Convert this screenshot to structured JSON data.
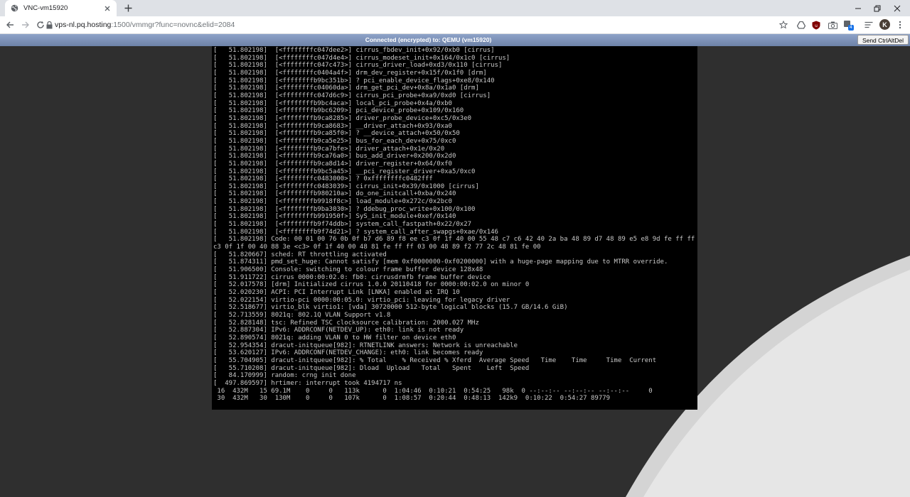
{
  "browser": {
    "tab_title": "VNC-vm15920",
    "url_host": "vps-nl.pq.hosting",
    "url_path": ":1500/vmmgr?func=novnc&elid=2084",
    "profile_initial": "K",
    "extension_badge": "4",
    "icons": [
      "globe-icon",
      "close-icon",
      "plus-icon",
      "back-arrow-icon",
      "forward-arrow-icon",
      "reload-icon",
      "lock-icon",
      "star-icon",
      "drive-icon",
      "ublock-icon",
      "camera-icon",
      "extension-icon",
      "reading-list-icon",
      "minimize-icon",
      "restore-icon",
      "window-close-icon"
    ]
  },
  "vnc": {
    "status": "Connected (encrypted) to: QEMU (vm15920)",
    "send_cad": "Send CtrlAltDel",
    "colors": {
      "statusbar": "#7b90b6",
      "console_bg": "#000000",
      "console_fg": "#c8c8c8",
      "page_bg": "#2f2f2f"
    }
  },
  "console": {
    "lines": [
      "[   51.802198]  [<ffffffffc047dee2>] cirrus_fbdev_init+0x92/0xb0 [cirrus]",
      "[   51.802198]  [<ffffffffc047d4e4>] cirrus_modeset_init+0x164/0x1c0 [cirrus]",
      "[   51.802198]  [<ffffffffc047c473>] cirrus_driver_load+0xd3/0x110 [cirrus]",
      "[   51.802198]  [<ffffffffc0404a4f>] drm_dev_register+0x15f/0x1f0 [drm]",
      "[   51.802198]  [<ffffffffb9bc351b>] ? pci_enable_device_flags+0xe8/0x140",
      "[   51.802198]  [<ffffffffc04060da>] drm_get_pci_dev+0x8a/0x1a0 [drm]",
      "[   51.802198]  [<ffffffffc047d6c9>] cirrus_pci_probe+0xa9/0xd0 [cirrus]",
      "[   51.802198]  [<ffffffffb9bc4aca>] local_pci_probe+0x4a/0xb0",
      "[   51.802198]  [<ffffffffb9bc6209>] pci_device_probe+0x109/0x160",
      "[   51.802198]  [<ffffffffb9ca8285>] driver_probe_device+0xc5/0x3e0",
      "[   51.802198]  [<ffffffffb9ca8683>] __driver_attach+0x93/0xa0",
      "[   51.802198]  [<ffffffffb9ca85f0>] ? __device_attach+0x50/0x50",
      "[   51.802198]  [<ffffffffb9ca5e25>] bus_for_each_dev+0x75/0xc0",
      "[   51.802198]  [<ffffffffb9ca7bfe>] driver_attach+0x1e/0x20",
      "[   51.802198]  [<ffffffffb9ca76a0>] bus_add_driver+0x200/0x2d0",
      "[   51.802198]  [<ffffffffb9ca8d14>] driver_register+0x64/0xf0",
      "[   51.802198]  [<ffffffffb9bc5a45>] __pci_register_driver+0xa5/0xc0",
      "[   51.802198]  [<ffffffffc0483000>] ? 0xffffffffc0482fff",
      "[   51.802198]  [<ffffffffc0483039>] cirrus_init+0x39/0x1000 [cirrus]",
      "[   51.802198]  [<ffffffffb980210a>] do_one_initcall+0xba/0x240",
      "[   51.802198]  [<ffffffffb9918f8c>] load_module+0x272c/0x2bc0",
      "[   51.802198]  [<ffffffffb9ba3030>] ? ddebug_proc_write+0x100/0x100",
      "[   51.802198]  [<ffffffffb991950f>] SyS_init_module+0xef/0x140",
      "[   51.802198]  [<ffffffffb9f74ddb>] system_call_fastpath+0x22/0x27",
      "[   51.802198]  [<ffffffffb9f74d21>] ? system_call_after_swapgs+0xae/0x146",
      "[   51.802198] Code: 00 01 00 76 0b 0f b7 d6 89 f8 ee c3 0f 1f 40 00 55 48 c7 c6 42 40 2a ba 48 89 d7 48 89 e5 e8 9d fe ff ff 5d",
      "c3 0f 1f 00 40 88 3e <c3> 0f 1f 40 00 48 81 fe ff ff 03 00 48 89 f2 77 2c 48 81 fe 00",
      "[   51.820667] sched: RT throttling activated",
      "[   51.874311] pmd_set_huge: Cannot satisfy [mem 0xf0000000-0xf0200000] with a huge-page mapping due to MTRR override.",
      "[   51.906500] Console: switching to colour frame buffer device 128x48",
      "[   51.911722] cirrus 0000:00:02.0: fb0: cirrusdrmfb frame buffer device",
      "[   52.017578] [drm] Initialized cirrus 1.0.0 20110418 for 0000:00:02.0 on minor 0",
      "[   52.020230] ACPI: PCI Interrupt Link [LNKA] enabled at IRQ 10",
      "[   52.022154] virtio-pci 0000:00:05.0: virtio_pci: leaving for legacy driver",
      "[   52.518677] virtio_blk virtio1: [vda] 30720000 512-byte logical blocks (15.7 GB/14.6 GiB)",
      "[   52.713559] 8021q: 802.1Q VLAN Support v1.8",
      "[   52.828148] tsc: Refined TSC clocksource calibration: 2000.027 MHz",
      "[   52.887304] IPv6: ADDRCONF(NETDEV_UP): eth0: link is not ready",
      "[   52.890574] 8021q: adding VLAN 0 to HW filter on device eth0",
      "[   52.954354] dracut-initqueue[982]: RTNETLINK answers: Network is unreachable",
      "[   53.620127] IPv6: ADDRCONF(NETDEV_CHANGE): eth0: link becomes ready",
      "[   55.704905] dracut-initqueue[982]: % Total    % Received % Xferd  Average Speed   Time    Time     Time  Current",
      "[   55.710208] dracut-initqueue[982]: Dload  Upload   Total   Spent    Left  Speed",
      "[   84.170999] random: crng init done",
      "[  497.869597] hrtimer: interrupt took 4194717 ns",
      " 16  432M   15 69.1M    0     0   113k      0  1:04:46  0:10:21  0:54:25   98k  0 --:--:-- --:--:-- --:--:--     0",
      " 30  432M   30  130M    0     0   107k      0  1:08:57  0:20:44  0:48:13  142k9  0:10:22  0:54:27 89779"
    ]
  }
}
